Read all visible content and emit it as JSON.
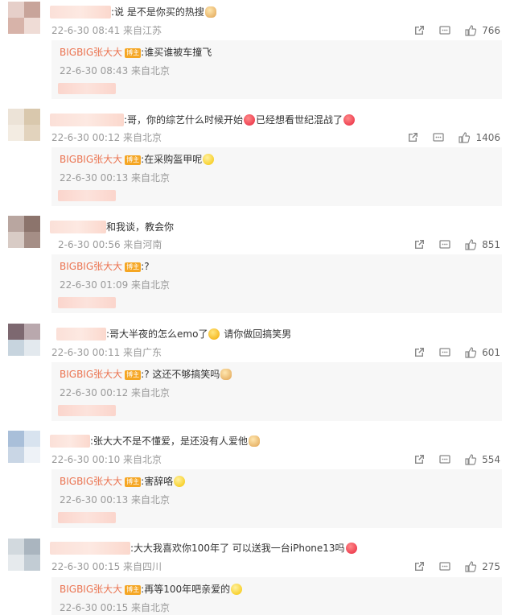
{
  "comments": [
    {
      "text": ":说 是不是你买的热搜",
      "emoji_after": "cat-emoji",
      "meta": "22-6-30 08:41 来自江苏",
      "likes": "766",
      "reply": {
        "name": "BIGBIG张大大",
        "badge": "博主",
        "text": ":谁买谁被车撞飞",
        "meta": "22-6-30 08:43 来自北京"
      }
    },
    {
      "text_a": ":哥，你的综艺什么时候开始",
      "text_b": "已经想看世纪混战了",
      "meta": "22-6-30 00:12 来自北京",
      "likes": "1406",
      "reply": {
        "name": "BIGBIG张大大",
        "badge": "博主",
        "text": ":在采购盔甲呢",
        "meta": "22-6-30 00:13 来自北京"
      }
    },
    {
      "text": "和我谈，教会你",
      "meta": "2-6-30 00:56 来自河南",
      "likes": "851",
      "reply": {
        "name": "BIGBIG张大大",
        "badge": "博主",
        "text": ":?",
        "meta": "22-6-30 01:09 来自北京"
      }
    },
    {
      "text_a": ":哥大半夜的怎么emo了",
      "text_b": "请你做回搞笑男",
      "meta": "22-6-30 00:11 来自广东",
      "likes": "601",
      "reply": {
        "name": "BIGBIG张大大",
        "badge": "博主",
        "text": ":? 这还不够搞笑吗",
        "meta": "22-6-30 00:12 来自北京"
      }
    },
    {
      "text": ":张大大不是不懂爱，是还没有人爱他",
      "meta": "22-6-30 00:10 来自北京",
      "likes": "554",
      "reply": {
        "name": "BIGBIG张大大",
        "badge": "博主",
        "text": ":害辞咯",
        "meta": "22-6-30 00:13 来自北京"
      }
    },
    {
      "text": ":大大我喜欢你100年了 可以送我一台iPhone13吗",
      "meta": "22-6-30 00:15 来自四川",
      "likes": "275",
      "reply": {
        "name": "BIGBIG张大大",
        "badge": "博主",
        "text": ":再等100年吧亲爱的",
        "meta": "22-6-30 00:15 来自北京"
      }
    }
  ]
}
